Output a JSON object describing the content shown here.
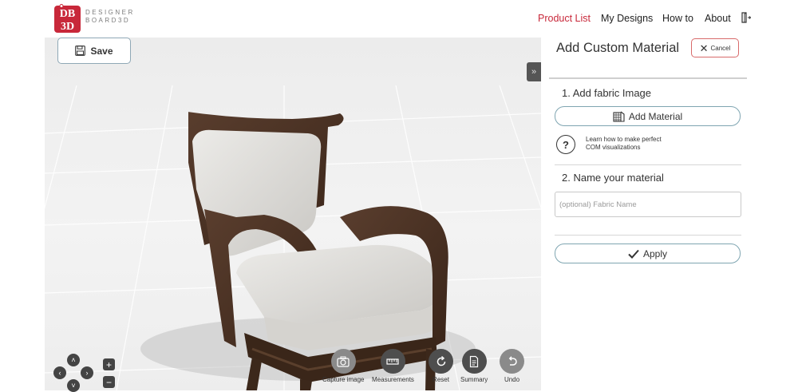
{
  "brand": {
    "logo_letters_top": "DB",
    "logo_letters_bottom": "3D",
    "line1": "DESIGNER",
    "line2": "BOARD3D",
    "color": "#c8283a"
  },
  "nav": {
    "product_list": "Product List",
    "my_designs": "My Designs",
    "how_to": "How to",
    "about": "About"
  },
  "toolbar": {
    "save_label": "Save"
  },
  "tools": {
    "capture": "Capture image",
    "measurements": "Measurements",
    "reset": "Reset",
    "summary": "Summary",
    "undo": "Undo"
  },
  "panel": {
    "title": "Add Custom Material",
    "cancel_label": "Cancel",
    "step1_title": "1. Add fabric Image",
    "add_material_label": "Add Material",
    "help_line1": "Learn how to make perfect",
    "help_line2": "COM visualizations",
    "step2_title": "2. Name your material",
    "fabric_name_placeholder": "(optional) Fabric Name",
    "fabric_name_value": "",
    "apply_label": "Apply"
  },
  "colors": {
    "accent": "#c8283a",
    "button_outline": "#7fa5b1",
    "cancel_outline": "#d86a6a"
  }
}
